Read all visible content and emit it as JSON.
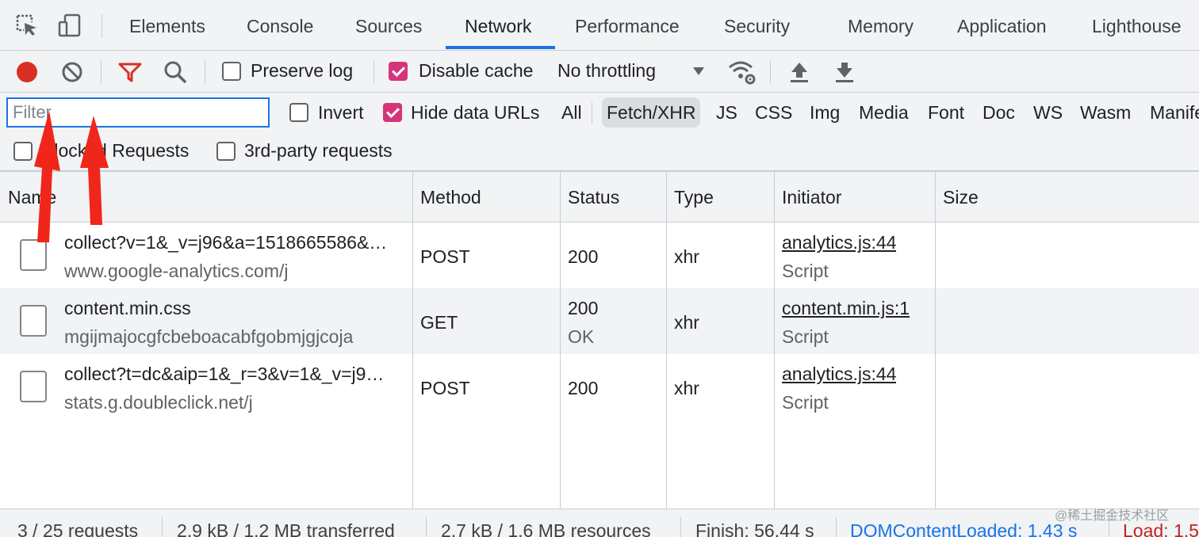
{
  "tabs": [
    {
      "label": "Elements",
      "active": false
    },
    {
      "label": "Console",
      "active": false
    },
    {
      "label": "Sources",
      "active": false
    },
    {
      "label": "Network",
      "active": true
    },
    {
      "label": "Performance",
      "active": false
    },
    {
      "label": "Security",
      "active": false
    },
    {
      "label": "Memory",
      "active": false
    },
    {
      "label": "Application",
      "active": false
    },
    {
      "label": "Lighthouse",
      "active": false
    }
  ],
  "toolbar": {
    "preserve_log_label": "Preserve log",
    "preserve_log_checked": false,
    "disable_cache_label": "Disable cache",
    "disable_cache_checked": true,
    "throttling_value": "No throttling"
  },
  "filter": {
    "placeholder": "Filter",
    "value": "",
    "invert_label": "Invert",
    "invert_checked": false,
    "hide_data_urls_label": "Hide data URLs",
    "hide_data_urls_checked": true,
    "types": [
      "All",
      "Fetch/XHR",
      "JS",
      "CSS",
      "Img",
      "Media",
      "Font",
      "Doc",
      "WS",
      "Wasm",
      "Manife"
    ],
    "active_type": "Fetch/XHR",
    "blocked_requests_label": "Blocked Requests",
    "third_party_label": "3rd-party requests"
  },
  "table": {
    "columns": [
      "Name",
      "Method",
      "Status",
      "Type",
      "Initiator",
      "Size"
    ],
    "rows": [
      {
        "name": "collect?v=1&_v=j96&a=1518665586&…",
        "domain": "www.google-analytics.com/j",
        "method": "POST",
        "status": "200",
        "status_text": "",
        "type": "xhr",
        "initiator": "analytics.js:44",
        "initiator_type": "Script",
        "size": ""
      },
      {
        "name": "content.min.css",
        "domain": "mgijmajocgfcbeboacabfgobmjgjcoja",
        "method": "GET",
        "status": "200",
        "status_text": "OK",
        "type": "xhr",
        "initiator": "content.min.js:1",
        "initiator_type": "Script",
        "size": ""
      },
      {
        "name": "collect?t=dc&aip=1&_r=3&v=1&_v=j9…",
        "domain": "stats.g.doubleclick.net/j",
        "method": "POST",
        "status": "200",
        "status_text": "",
        "type": "xhr",
        "initiator": "analytics.js:44",
        "initiator_type": "Script",
        "size": ""
      }
    ]
  },
  "status": {
    "requests": "3 / 25 requests",
    "transferred": "2.9 kB / 1.2 MB transferred",
    "resources": "2.7 kB / 1.6 MB resources",
    "finish": "Finish: 56.44 s",
    "dom_content_loaded": "DOMContentLoaded: 1.43 s",
    "load": "Load: 1.5"
  },
  "watermark": "@稀土掘金技术社区",
  "colors": {
    "accent": "#1a73e8",
    "record": "#d93025",
    "filter_icon": "#d93025",
    "checkbox_checked": "#d6347a",
    "arrow": "#f0261b",
    "dcl": "#1a73e8",
    "load": "#c5221f"
  }
}
